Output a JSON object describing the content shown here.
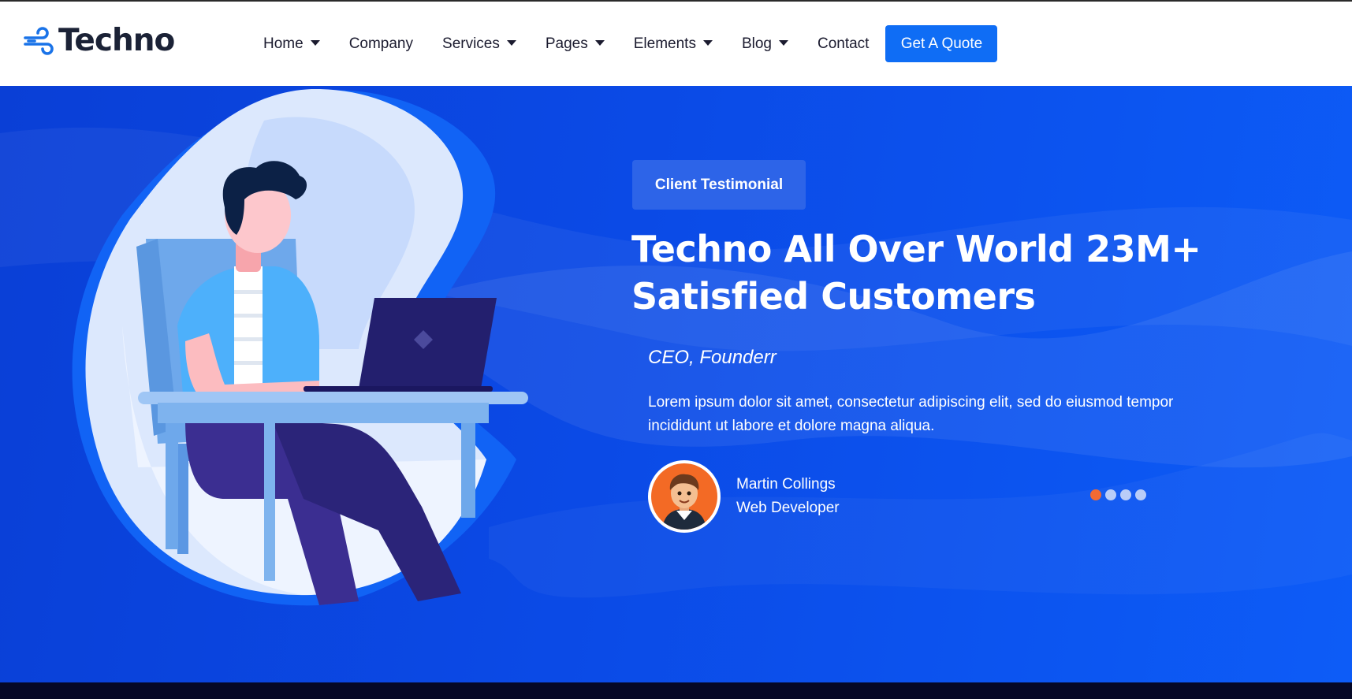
{
  "brand": {
    "name": "Techno",
    "accent": "#0f6df5"
  },
  "nav": {
    "items": [
      {
        "label": "Home",
        "dropdown": true
      },
      {
        "label": "Company",
        "dropdown": false
      },
      {
        "label": "Services",
        "dropdown": true
      },
      {
        "label": "Pages",
        "dropdown": true
      },
      {
        "label": "Elements",
        "dropdown": true
      },
      {
        "label": "Blog",
        "dropdown": true
      },
      {
        "label": "Contact",
        "dropdown": false
      }
    ],
    "cta_label": "Get A Quote"
  },
  "hero": {
    "tag_label": "Client Testimonial",
    "title": "Techno All Over World 23M+ Satisfied Customers",
    "role": "CEO, Founderr",
    "quote": "Lorem ipsum dolor sit amet, consectetur adipiscing elit, sed do eiusmod tempor incididunt ut labore et dolore magna aliqua.",
    "author": {
      "name": "Martin Collings",
      "title": "Web Developer"
    },
    "carousel": {
      "slide_count": 4,
      "active_index": 0,
      "active_color": "#f26a33"
    }
  }
}
